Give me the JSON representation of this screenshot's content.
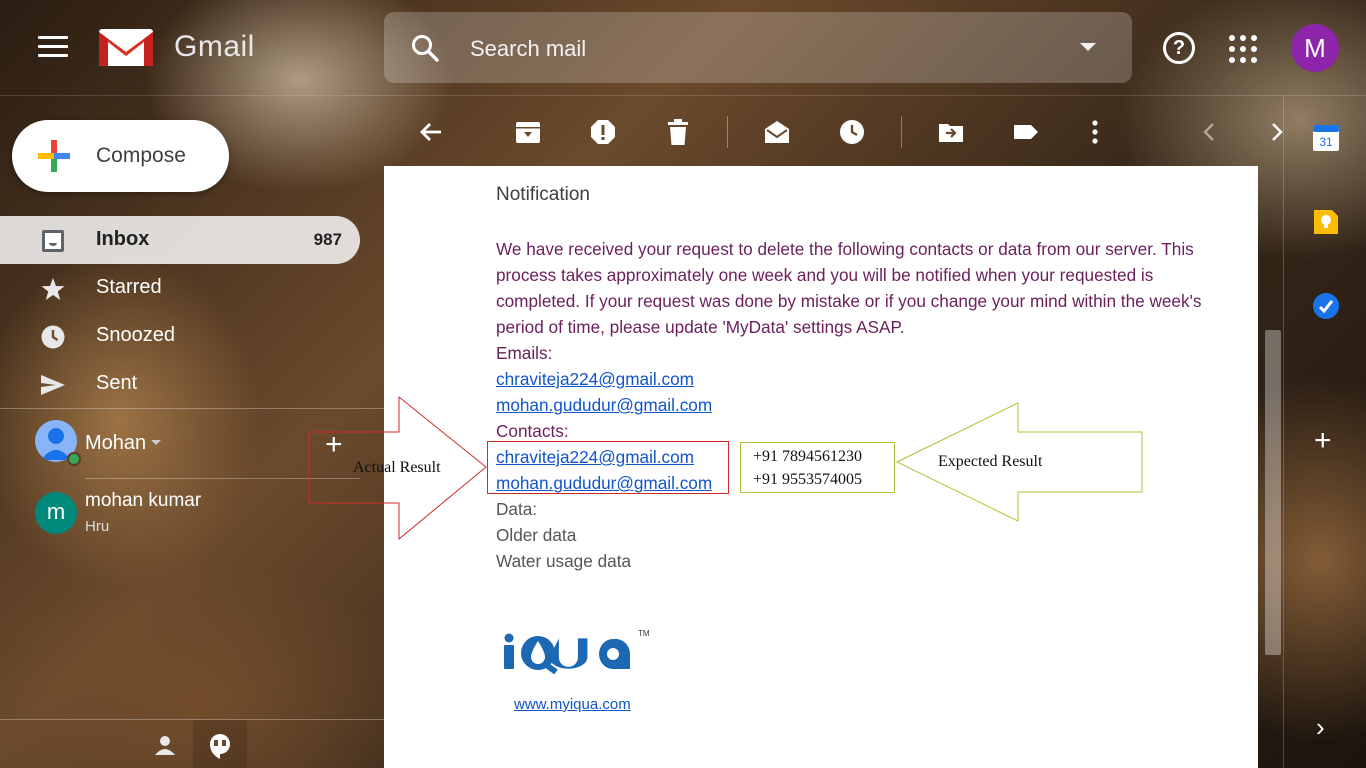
{
  "app": {
    "name": "Gmail",
    "search_placeholder": "Search mail",
    "account_initial": "M",
    "help_glyph": "?"
  },
  "sidebar": {
    "compose_label": "Compose",
    "items": [
      {
        "label": "Inbox",
        "count": "987",
        "icon": "inbox-icon",
        "active": true
      },
      {
        "label": "Starred",
        "count": "",
        "icon": "star-icon",
        "active": false
      },
      {
        "label": "Snoozed",
        "count": "",
        "icon": "clock-icon",
        "active": false
      },
      {
        "label": "Sent",
        "count": "",
        "icon": "send-icon",
        "active": false
      }
    ],
    "hangouts": {
      "user_name": "Mohan",
      "add_glyph": "+",
      "contacts": [
        {
          "initial": "m",
          "name": "mohan kumar",
          "subtitle": "Hru"
        }
      ]
    }
  },
  "toolbar": {
    "icons": [
      "back-arrow-icon",
      "archive-icon",
      "report-spam-icon",
      "delete-icon",
      "mark-unread-icon",
      "snooze-icon",
      "move-to-icon",
      "label-icon",
      "more-icon",
      "newer-icon",
      "older-icon"
    ]
  },
  "email": {
    "title": "Notification",
    "body": "We have received your request to delete the following contacts or data from our server. This process takes approximately one week and you will be notified when your requested is completed. If your request was done by mistake or if you change your mind within the week's period of time, please update 'MyData' settings ASAP.",
    "emails_heading": "Emails:",
    "emails": [
      "chraviteja224@gmail.com",
      "mohan.gududur@gmail.com"
    ],
    "contacts_heading": "Contacts:",
    "contacts": [
      "chraviteja224@gmail.com",
      "mohan.gududur@gmail.com"
    ],
    "data_heading": "Data:",
    "data_items": [
      "Older data",
      "Water usage data"
    ],
    "brand_logo_text": "iQua",
    "brand_tm": "TM",
    "website": "www.myiqua.com"
  },
  "annotations": {
    "actual_label": "Actual Result",
    "expected_label": "Expected Result",
    "expected_values": [
      "+91 7894561230",
      "+91 9553574005"
    ],
    "actual_color": "#d12a2a",
    "expected_color": "#a6c63a"
  },
  "side_panel": {
    "icons": [
      "calendar-icon",
      "keep-icon",
      "tasks-icon"
    ],
    "calendar_day": "31",
    "add_glyph": "+",
    "expand_glyph": "›"
  },
  "colors": {
    "account_avatar": "#8e24aa",
    "contact_avatar": "#00897b",
    "link": "#1155cc",
    "body_text": "#6b1f5c"
  }
}
